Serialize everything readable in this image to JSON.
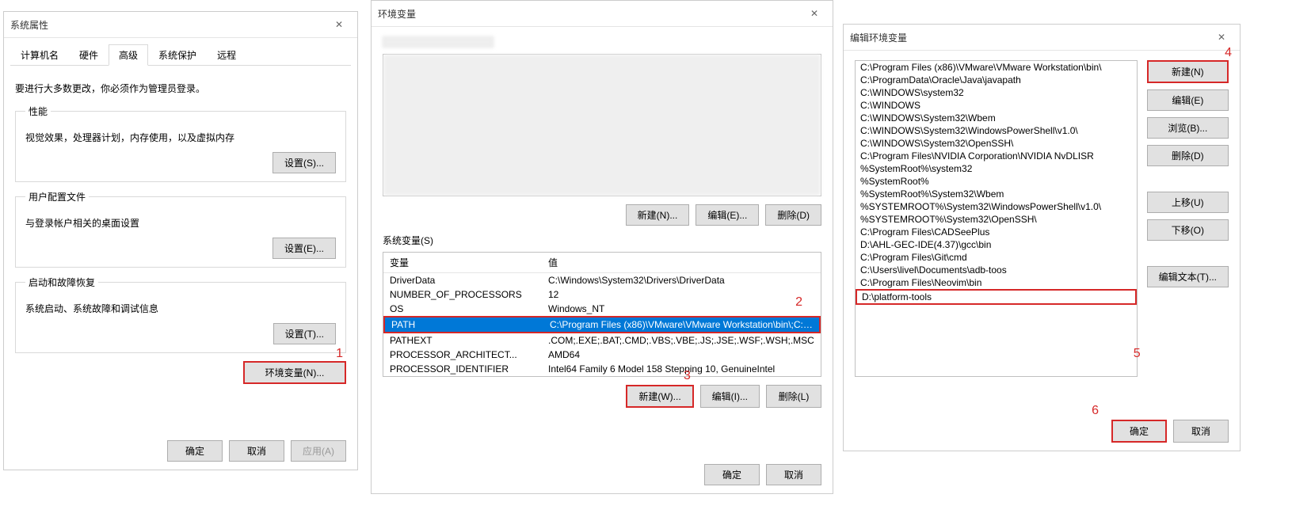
{
  "sysprops": {
    "title": "系统属性",
    "tabs": [
      "计算机名",
      "硬件",
      "高级",
      "系统保护",
      "远程"
    ],
    "active_tab": 2,
    "admin_note": "要进行大多数更改，你必须作为管理员登录。",
    "perf": {
      "legend": "性能",
      "desc": "视觉效果，处理器计划，内存使用，以及虚拟内存",
      "btn": "设置(S)..."
    },
    "profiles": {
      "legend": "用户配置文件",
      "desc": "与登录帐户相关的桌面设置",
      "btn": "设置(E)..."
    },
    "startup": {
      "legend": "启动和故障恢复",
      "desc": "系统启动、系统故障和调试信息",
      "btn": "设置(T)..."
    },
    "envvar_btn": "环境变量(N)...",
    "ok": "确定",
    "cancel": "取消",
    "apply": "应用(A)"
  },
  "envvars": {
    "title": "环境变量",
    "sysvars_label": "系统变量(S)",
    "col_name": "变量",
    "col_val": "值",
    "rows": [
      {
        "name": "DriverData",
        "value": "C:\\Windows\\System32\\Drivers\\DriverData"
      },
      {
        "name": "NUMBER_OF_PROCESSORS",
        "value": "12"
      },
      {
        "name": "OS",
        "value": "Windows_NT"
      },
      {
        "name": "PATH",
        "value": "C:\\Program Files (x86)\\VMware\\VMware Workstation\\bin\\;C:\\..."
      },
      {
        "name": "PATHEXT",
        "value": ".COM;.EXE;.BAT;.CMD;.VBS;.VBE;.JS;.JSE;.WSF;.WSH;.MSC"
      },
      {
        "name": "PROCESSOR_ARCHITECT...",
        "value": "AMD64"
      },
      {
        "name": "PROCESSOR_IDENTIFIER",
        "value": "Intel64 Family 6 Model 158 Stepping 10, GenuineIntel"
      }
    ],
    "selected_row": 3,
    "user_btns": {
      "new": "新建(N)...",
      "edit": "编辑(E)...",
      "delete": "删除(D)"
    },
    "sys_btns": {
      "new": "新建(W)...",
      "edit": "编辑(I)...",
      "delete": "删除(L)"
    },
    "ok": "确定",
    "cancel": "取消"
  },
  "editpath": {
    "title": "编辑环境变量",
    "items": [
      "C:\\Program Files (x86)\\VMware\\VMware Workstation\\bin\\",
      "C:\\ProgramData\\Oracle\\Java\\javapath",
      "C:\\WINDOWS\\system32",
      "C:\\WINDOWS",
      "C:\\WINDOWS\\System32\\Wbem",
      "C:\\WINDOWS\\System32\\WindowsPowerShell\\v1.0\\",
      "C:\\WINDOWS\\System32\\OpenSSH\\",
      "C:\\Program Files\\NVIDIA Corporation\\NVIDIA NvDLISR",
      "%SystemRoot%\\system32",
      "%SystemRoot%",
      "%SystemRoot%\\System32\\Wbem",
      "%SYSTEMROOT%\\System32\\WindowsPowerShell\\v1.0\\",
      "%SYSTEMROOT%\\System32\\OpenSSH\\",
      "C:\\Program Files\\CADSeePlus",
      "D:\\AHL-GEC-IDE(4.37)\\gcc\\bin",
      "C:\\Program Files\\Git\\cmd",
      "C:\\Users\\livel\\Documents\\adb-toos",
      "C:\\Program Files\\Neovim\\bin",
      "D:\\platform-tools"
    ],
    "btns": {
      "new": "新建(N)",
      "edit": "编辑(E)",
      "browse": "浏览(B)...",
      "delete": "删除(D)",
      "up": "上移(U)",
      "down": "下移(O)",
      "edittext": "编辑文本(T)..."
    },
    "ok": "确定",
    "cancel": "取消"
  },
  "annotations": {
    "l1": "1",
    "l2": "2",
    "l3": "3",
    "l4": "4",
    "l5": "5",
    "l6": "6"
  }
}
